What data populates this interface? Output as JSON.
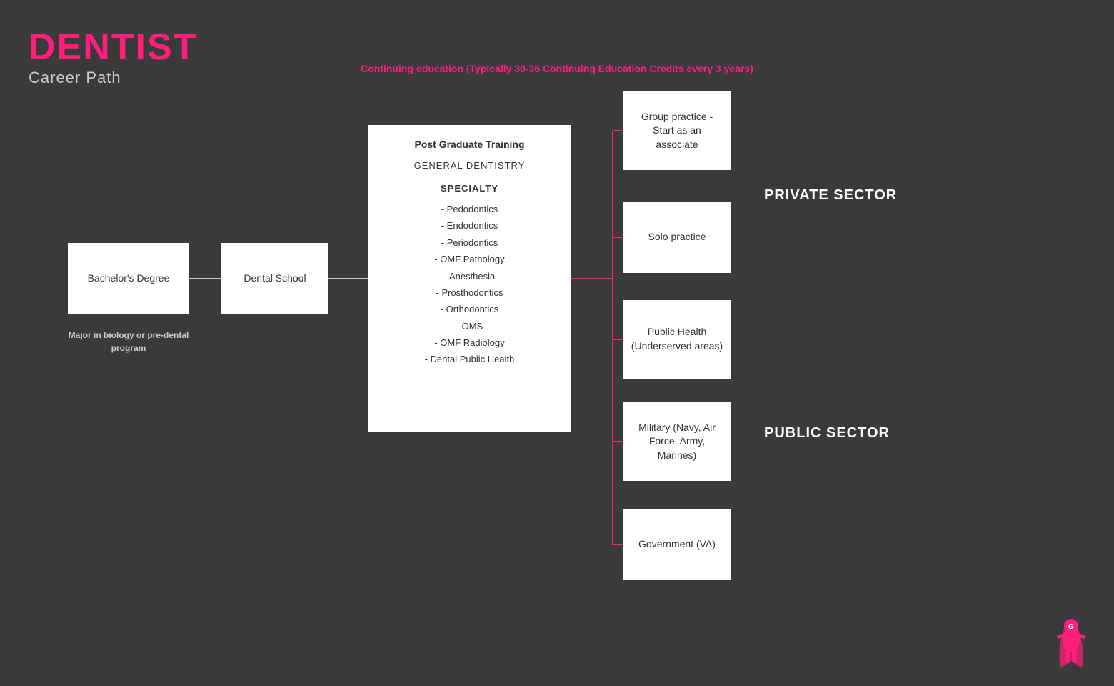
{
  "title": {
    "main": "DENTIST",
    "sub": "Career Path"
  },
  "continuing_ed": "Continuing education (Typically 30-36 Continuing Education Credits every 3 years)",
  "boxes": {
    "bachelor": "Bachelor's Degree",
    "dental_school": "Dental School",
    "postgrad": {
      "title": "Post Graduate Training",
      "general": "GENERAL DENTISTRY",
      "specialty_title": "SPECIALTY",
      "specialty_items": [
        "- Pedodontics",
        "- Endodontics",
        "- Periodontics",
        "- OMF Pathology",
        "- Anesthesia",
        "- Prosthodontics",
        "- Orthodontics",
        "- OMS",
        "- OMF Radiology",
        "- Dental Public Health"
      ]
    },
    "group_practice": "Group practice - Start as an associate",
    "solo_practice": "Solo practice",
    "public_health": "Public Health (Underserved areas)",
    "military": "Military (Navy, Air Force, Army, Marines)",
    "government": "Government (VA)"
  },
  "sectors": {
    "private": "PRIVATE SECTOR",
    "public": "PUBLIC SECTOR"
  },
  "major_note": "Major in biology or pre-dental program",
  "colors": {
    "accent": "#ff1f7a",
    "background": "#3a3a3a",
    "box_bg": "#ffffff",
    "text_light": "#cccccc",
    "text_dark": "#333333",
    "sector_label": "#ffffff"
  }
}
